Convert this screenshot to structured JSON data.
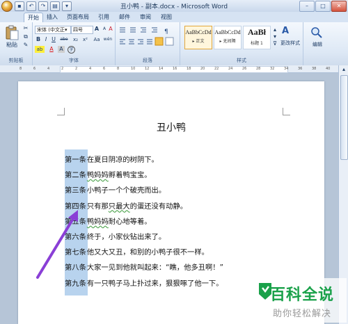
{
  "window": {
    "title": "丑小鸭 - 副本.docx - Microsoft Word",
    "minimize": "–",
    "maximize": "□",
    "close": "✕"
  },
  "tabs": [
    "开始",
    "插入",
    "页面布局",
    "引用",
    "邮件",
    "审阅",
    "视图"
  ],
  "ribbon": {
    "clipboard": {
      "label": "剪贴板",
      "paste": "粘贴"
    },
    "font": {
      "label": "字体",
      "font_name": "宋体 (中文正▾",
      "font_size": "四号",
      "bold": "B",
      "italic": "I",
      "underline": "U",
      "strike": "abe",
      "subscript": "x₂",
      "superscript": "x²",
      "change_case": "Aa",
      "grow": "A",
      "shrink": "A",
      "clear": "A",
      "phonetic": "wén",
      "highlight": "ab",
      "font_color": "A",
      "char_shade": "A",
      "enclose": "字"
    },
    "paragraph": {
      "label": "段落"
    },
    "styles": {
      "label": "样式",
      "items": [
        {
          "sample": "AaBbCcDd",
          "name": "▸ 正文"
        },
        {
          "sample": "AaBbCcDd",
          "name": "▸ 无间隔"
        },
        {
          "sample": "AaBł",
          "name": "标题 1"
        }
      ],
      "change_styles": "更改样式"
    },
    "editing": {
      "label": "编辑"
    }
  },
  "ruler": {
    "ticks": [
      "8",
      "6",
      "4",
      "2",
      "2",
      "4",
      "6",
      "8",
      "10",
      "12",
      "14",
      "16",
      "18",
      "20",
      "22",
      "24",
      "26",
      "28",
      "32",
      "34",
      "36",
      "38",
      "40"
    ]
  },
  "document": {
    "title": "丑小鸭",
    "lines": [
      {
        "label": "第一条",
        "text": "在夏日阴凉的树阴下。"
      },
      {
        "label": "第二条",
        "text_squiggle": "鸭妈妈",
        "text": "孵着鸭宝宝。"
      },
      {
        "label": "第三条",
        "text": "小鸭子一个个破壳而出。"
      },
      {
        "label": "第四条",
        "text_pre": "只有那",
        "text_squiggle": "只最大",
        "text": "的蛋还没有动静。"
      },
      {
        "label": "第五条",
        "text_squiggle": "鸭妈妈",
        "text": "耐心地等着。"
      },
      {
        "label": "第六条",
        "text": "终于，小家伙钻出来了。"
      },
      {
        "label": "第七条",
        "text": "他又大又丑，和别的小鸭子很不一样。"
      },
      {
        "label": "第八条",
        "text": "大家一见到他就叫起来：“瞧，他多丑啊！”"
      },
      {
        "label": "第九条",
        "text": "有一只鸭子马上扑过来，狠狠啄了他一下。"
      }
    ]
  },
  "watermark": {
    "brand": "百科全说",
    "sub": "助你轻松解决"
  },
  "colors": {
    "arrow": "#8a3fd6",
    "selection": "#b8d3ee",
    "brand_green": "#1aa14a"
  }
}
